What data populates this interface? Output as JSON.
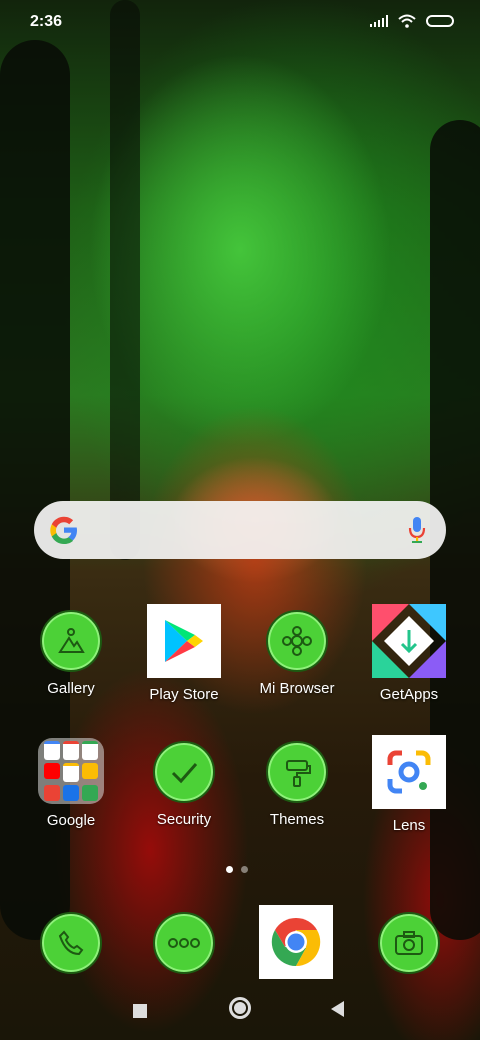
{
  "status_bar": {
    "time": "2:36"
  },
  "search": {
    "google_letter": "G"
  },
  "apps": {
    "gallery": "Gallery",
    "play_store": "Play Store",
    "mi_browser": "Mi Browser",
    "getapps": "GetApps",
    "google": "Google",
    "security": "Security",
    "themes": "Themes",
    "lens": "Lens"
  },
  "dock": [
    "phone-icon",
    "messages-icon",
    "chrome-icon",
    "camera-icon"
  ],
  "page_indicator": {
    "pages": 2,
    "current": 1
  },
  "navigation": [
    "recents-button",
    "home-button",
    "back-button"
  ],
  "colors": {
    "icon_green": "#4cd137",
    "icon_border": "#1d5a12",
    "accent_blue": "#4285f4"
  }
}
